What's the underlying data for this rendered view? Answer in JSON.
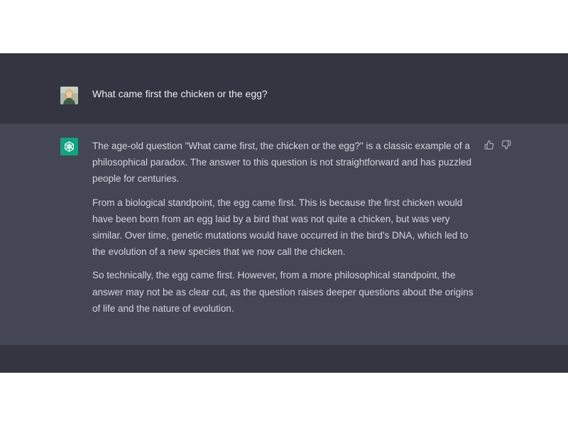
{
  "user_message": {
    "text": "What came first the chicken or the egg?",
    "avatar_icon": "user-avatar"
  },
  "assistant_message": {
    "icon": "openai-logo-icon",
    "paragraphs": [
      "The age-old question \"What came first, the chicken or the egg?\" is a classic example of a philosophical paradox. The answer to this question is not straightforward and has puzzled people for centuries.",
      "From a biological standpoint, the egg came first. This is because the first chicken would have been born from an egg laid by a bird that was not quite a chicken, but was very similar. Over time, genetic mutations would have occurred in the bird's DNA, which led to the evolution of a new species that we now call the chicken.",
      "So technically, the egg came first. However, from a more philosophical standpoint, the answer may not be as clear cut, as the question raises deeper questions about the origins of life and the nature of evolution."
    ],
    "feedback_icons": [
      "thumbs-up-icon",
      "thumbs-down-icon"
    ]
  },
  "colors": {
    "page_bg": "#343541",
    "assistant_bg": "#444654",
    "bot_accent": "#10a37f",
    "text": "#d1d5db"
  }
}
